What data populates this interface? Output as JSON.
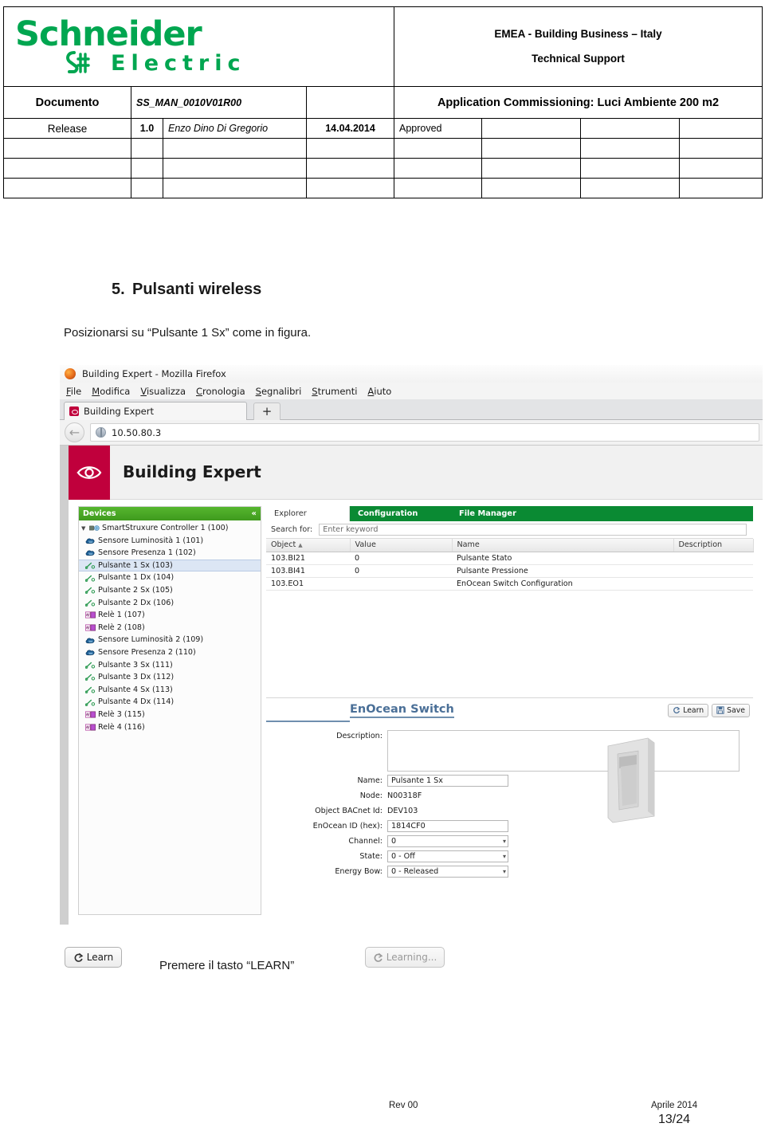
{
  "header": {
    "logo": {
      "line1": "Schneider",
      "line2": "Electric"
    },
    "org_line1": "EMEA - Building Business – Italy",
    "org_line2": "Technical Support",
    "labels": {
      "documento": "Documento",
      "release": "Release",
      "approved": "Approved"
    },
    "values": {
      "doc_number": "SS_MAN_0010V01R00",
      "app_title": "Application Commissioning: Luci Ambiente 200 m2",
      "release_version": "1.0",
      "author": "Enzo Dino Di Gregorio",
      "date": "14.04.2014"
    }
  },
  "section": {
    "number": "5.",
    "title": "Pulsanti wireless",
    "intro": "Posizionarsi su “Pulsante 1 Sx” come in figura."
  },
  "browser": {
    "window_title": "Building Expert - Mozilla Firefox",
    "menu": [
      {
        "accel": "F",
        "rest": "ile"
      },
      {
        "accel": "M",
        "rest": "odifica"
      },
      {
        "accel": "V",
        "rest": "isualizza"
      },
      {
        "accel": "C",
        "rest": "ronologia"
      },
      {
        "accel": "S",
        "rest": "egnalibri"
      },
      {
        "accel": "S",
        "rest": "trumenti"
      },
      {
        "accel": "A",
        "rest": "iuto"
      }
    ],
    "tab_label": "Building Expert",
    "new_tab_label": "+",
    "url": "10.50.80.3"
  },
  "app": {
    "title": "Building Expert",
    "devices_panel": {
      "header": "Devices",
      "collapse_glyph": "«",
      "items": [
        {
          "label": "SmartStruxure Controller 1 (100)",
          "icon": "controller-icon",
          "root": true,
          "selected": false
        },
        {
          "label": "Sensore Luminosità 1 (101)",
          "icon": "sensor-icon",
          "root": false,
          "selected": false
        },
        {
          "label": "Sensore Presenza 1 (102)",
          "icon": "sensor-icon",
          "root": false,
          "selected": false
        },
        {
          "label": "Pulsante 1 Sx (103)",
          "icon": "switch-icon",
          "root": false,
          "selected": true
        },
        {
          "label": "Pulsante 1 Dx (104)",
          "icon": "switch-icon",
          "root": false,
          "selected": false
        },
        {
          "label": "Pulsante 2 Sx (105)",
          "icon": "switch-icon",
          "root": false,
          "selected": false
        },
        {
          "label": "Pulsante 2 Dx (106)",
          "icon": "switch-icon",
          "root": false,
          "selected": false
        },
        {
          "label": "Relè 1 (107)",
          "icon": "relay-icon",
          "root": false,
          "selected": false
        },
        {
          "label": "Relè 2 (108)",
          "icon": "relay-icon",
          "root": false,
          "selected": false
        },
        {
          "label": "Sensore Luminosità 2 (109)",
          "icon": "sensor-icon",
          "root": false,
          "selected": false
        },
        {
          "label": "Sensore Presenza 2 (110)",
          "icon": "sensor-icon",
          "root": false,
          "selected": false
        },
        {
          "label": "Pulsante 3 Sx (111)",
          "icon": "switch-icon",
          "root": false,
          "selected": false
        },
        {
          "label": "Pulsante 3 Dx (112)",
          "icon": "switch-icon",
          "root": false,
          "selected": false
        },
        {
          "label": "Pulsante 4 Sx (113)",
          "icon": "switch-icon",
          "root": false,
          "selected": false
        },
        {
          "label": "Pulsante 4 Dx (114)",
          "icon": "switch-icon",
          "root": false,
          "selected": false
        },
        {
          "label": "Relè 3 (115)",
          "icon": "relay-icon",
          "root": false,
          "selected": false
        },
        {
          "label": "Relè 4 (116)",
          "icon": "relay-icon",
          "root": false,
          "selected": false
        }
      ]
    },
    "tabs": [
      {
        "label": "Explorer",
        "active": true
      },
      {
        "label": "Configuration",
        "active": false
      },
      {
        "label": "File Manager",
        "active": false
      }
    ],
    "search": {
      "label": "Search for:",
      "placeholder": "Enter keyword",
      "value": ""
    },
    "grid": {
      "columns": [
        "Object",
        "Value",
        "Name",
        "Description"
      ],
      "sort_glyph": "▲",
      "rows": [
        {
          "object": "103.BI21",
          "value": "0",
          "name": "Pulsante Stato",
          "description": ""
        },
        {
          "object": "103.BI41",
          "value": "0",
          "name": "Pulsante Pressione",
          "description": ""
        },
        {
          "object": "103.EO1",
          "value": "",
          "name": "EnOcean Switch Configuration",
          "description": ""
        }
      ]
    },
    "enocean": {
      "panel_title": "EnOcean Switch",
      "buttons": [
        {
          "label": "Learn",
          "icon": "refresh-icon"
        },
        {
          "label": "Save",
          "icon": "save-icon"
        }
      ],
      "fields": [
        {
          "label": "Description:",
          "value": "",
          "type": "textarea"
        },
        {
          "label": "Name:",
          "value": "Pulsante 1 Sx",
          "type": "input"
        },
        {
          "label": "Node:",
          "value": "N00318F",
          "type": "static"
        },
        {
          "label": "Object BACnet Id:",
          "value": "DEV103",
          "type": "static"
        },
        {
          "label": "EnOcean ID (hex):",
          "value": "1814CF0",
          "type": "input"
        },
        {
          "label": "Channel:",
          "value": "0",
          "type": "select"
        },
        {
          "label": "State:",
          "value": "0 - Off",
          "type": "select"
        },
        {
          "label": "Energy Bow:",
          "value": "0 - Released",
          "type": "select"
        }
      ],
      "select_caret": "⌄"
    }
  },
  "bottom": {
    "learn_button": "Learn",
    "learning_button": "Learning...",
    "instruction": "Premere il tasto “LEARN”"
  },
  "footer": {
    "rev": "Rev 00",
    "date": "Aprile 2014",
    "page": "13/24"
  },
  "colors": {
    "brand_green": "#00a650",
    "brand_pink": "#c0003c",
    "tab_green": "#0a8a33",
    "tree_green": "#4caf28",
    "panel_blue": "#4a6f97"
  }
}
